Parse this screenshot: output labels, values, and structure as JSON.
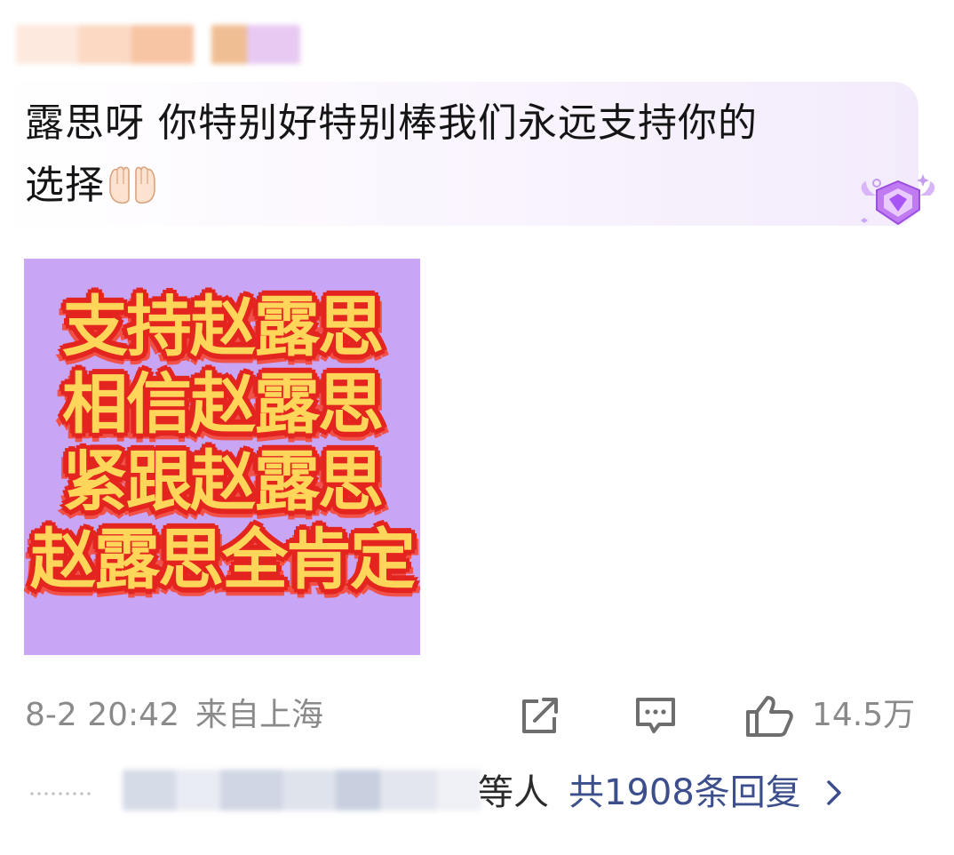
{
  "comment": {
    "text_line1": "露思呀 你特别好特别棒我们永远支持你的",
    "text_line2": "选择",
    "emoji": "raising-hands-emoji"
  },
  "badge": {
    "icon": "gem-badge-icon",
    "color": "#b266f0"
  },
  "image": {
    "background": "#c9a6f5",
    "lines": [
      "支持赵露思",
      "相信赵露思",
      "紧跟赵露思",
      "赵露思全肯定"
    ]
  },
  "meta": {
    "date": "8-2 20:42",
    "location": "来自上海",
    "share_icon": "share-icon",
    "comment_icon": "comment-icon",
    "like_icon": "thumbs-up-icon",
    "likes": "14.5万"
  },
  "replies": {
    "suffix": "等人",
    "count_label": "共1908条回复",
    "link_color": "#3c4f8c"
  }
}
